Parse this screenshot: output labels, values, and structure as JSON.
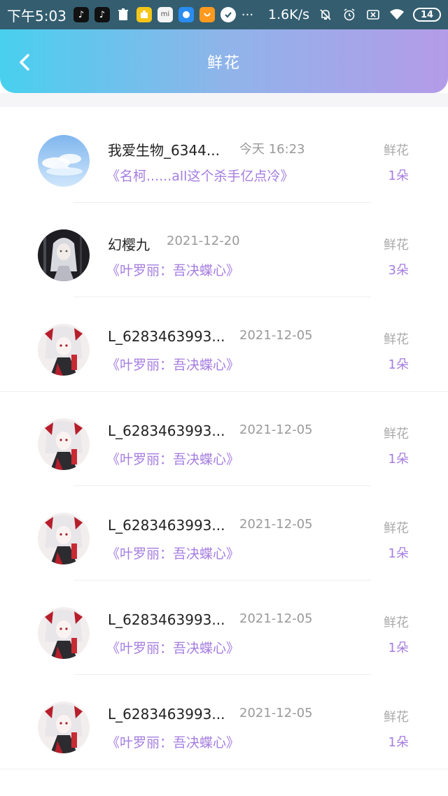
{
  "status_bar": {
    "time": "下午5:03",
    "net_speed": "1.6K/s",
    "battery": "14",
    "more": "···"
  },
  "nav": {
    "title": "鲜花"
  },
  "records": [
    {
      "name": "我爱生物_6344...",
      "date": "今天 16:23",
      "book": "《名柯......all这个杀手亿点冷》",
      "label": "鲜花",
      "count": "1朵",
      "avatar": "sky"
    },
    {
      "name": "幻樱九",
      "date": "2021-12-20",
      "book": "《叶罗丽：吾决蝶心》",
      "label": "鲜花",
      "count": "3朵",
      "avatar": "dark-anime"
    },
    {
      "name": "L_6283463993...",
      "date": "2021-12-05",
      "book": "《叶罗丽：吾决蝶心》",
      "label": "鲜花",
      "count": "1朵",
      "avatar": "red-anime"
    },
    {
      "name": "L_6283463993...",
      "date": "2021-12-05",
      "book": "《叶罗丽：吾决蝶心》",
      "label": "鲜花",
      "count": "1朵",
      "avatar": "red-anime"
    },
    {
      "name": "L_6283463993...",
      "date": "2021-12-05",
      "book": "《叶罗丽：吾决蝶心》",
      "label": "鲜花",
      "count": "1朵",
      "avatar": "red-anime"
    },
    {
      "name": "L_6283463993...",
      "date": "2021-12-05",
      "book": "《叶罗丽：吾决蝶心》",
      "label": "鲜花",
      "count": "1朵",
      "avatar": "red-anime"
    },
    {
      "name": "L_6283463993...",
      "date": "2021-12-05",
      "book": "《叶罗丽：吾决蝶心》",
      "label": "鲜花",
      "count": "1朵",
      "avatar": "red-anime"
    }
  ],
  "colors": {
    "accent_purple": "#a57de0",
    "header_gradient_start": "#48d0ee",
    "header_gradient_end": "#b49be8"
  }
}
